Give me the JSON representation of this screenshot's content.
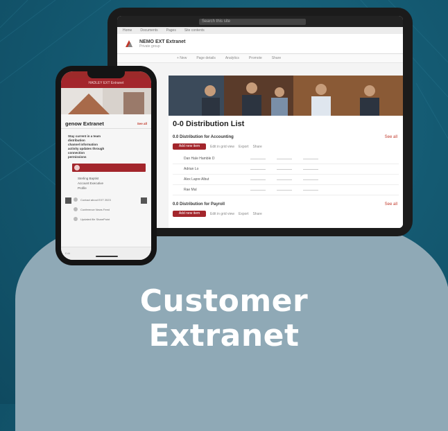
{
  "hero": {
    "line1": "Customer",
    "line2": "Extranet"
  },
  "tablet": {
    "search_placeholder": "Search this site",
    "nav": [
      "Home",
      "Documents",
      "Pages",
      "Site contents"
    ],
    "site_title": "NEMO EXT Extranet",
    "site_subtitle": "Private group",
    "commands": [
      "+ New",
      "Page details",
      "Analytics",
      "Promote",
      "Share"
    ],
    "page_title": "0-0 Distribution List",
    "section1": "0.0 Distribution for Accounting",
    "section2": "0.0 Distribution for Payroll",
    "see_all": "See all",
    "button": "Add new item",
    "toolbar": [
      "Edit in grid view",
      "Export",
      "Share"
    ],
    "rows": [
      {
        "name": "Dan Hale Hamble D"
      },
      {
        "name": "Adrian Lo"
      },
      {
        "name": "Alex Lapre Albut"
      },
      {
        "name": "Rae Mal"
      }
    ]
  },
  "phone": {
    "topbar": "HADLEY EXT Extranet",
    "title": "genow Extranet",
    "see_all": "See all",
    "body_lines": [
      "Stay current in a team",
      "distribution",
      "channel information",
      "activity updates through",
      "connection",
      "permissions"
    ],
    "person": "Sterling Baptist",
    "sub_lines": [
      "Account Executive",
      "Profile"
    ],
    "items": [
      "Contact about EXT 2023",
      "Conference News Feed",
      "Updated file SharePoint"
    ],
    "bottom": "Edit"
  }
}
